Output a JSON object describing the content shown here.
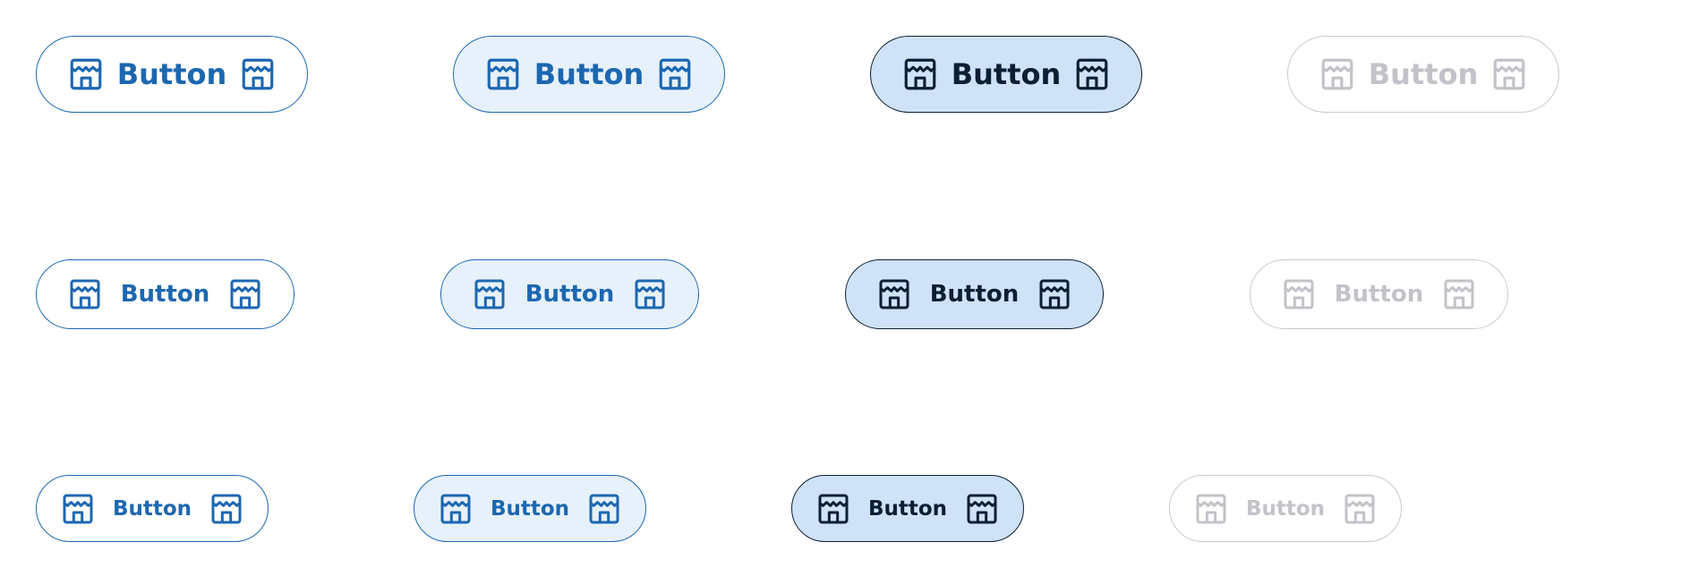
{
  "buttons": {
    "label": "Button",
    "icon": "shop-icon",
    "states": [
      "default",
      "hover",
      "pressed",
      "disabled"
    ],
    "sizes": [
      "large",
      "medium",
      "small"
    ]
  },
  "colors": {
    "primary": "#1d67b1",
    "hover_bg": "#e7f1fb",
    "pressed_bg": "#cfe2f7",
    "pressed_fg": "#0b1e33",
    "disabled_fg": "#c1c3c8",
    "disabled_border": "#c9cacd"
  }
}
